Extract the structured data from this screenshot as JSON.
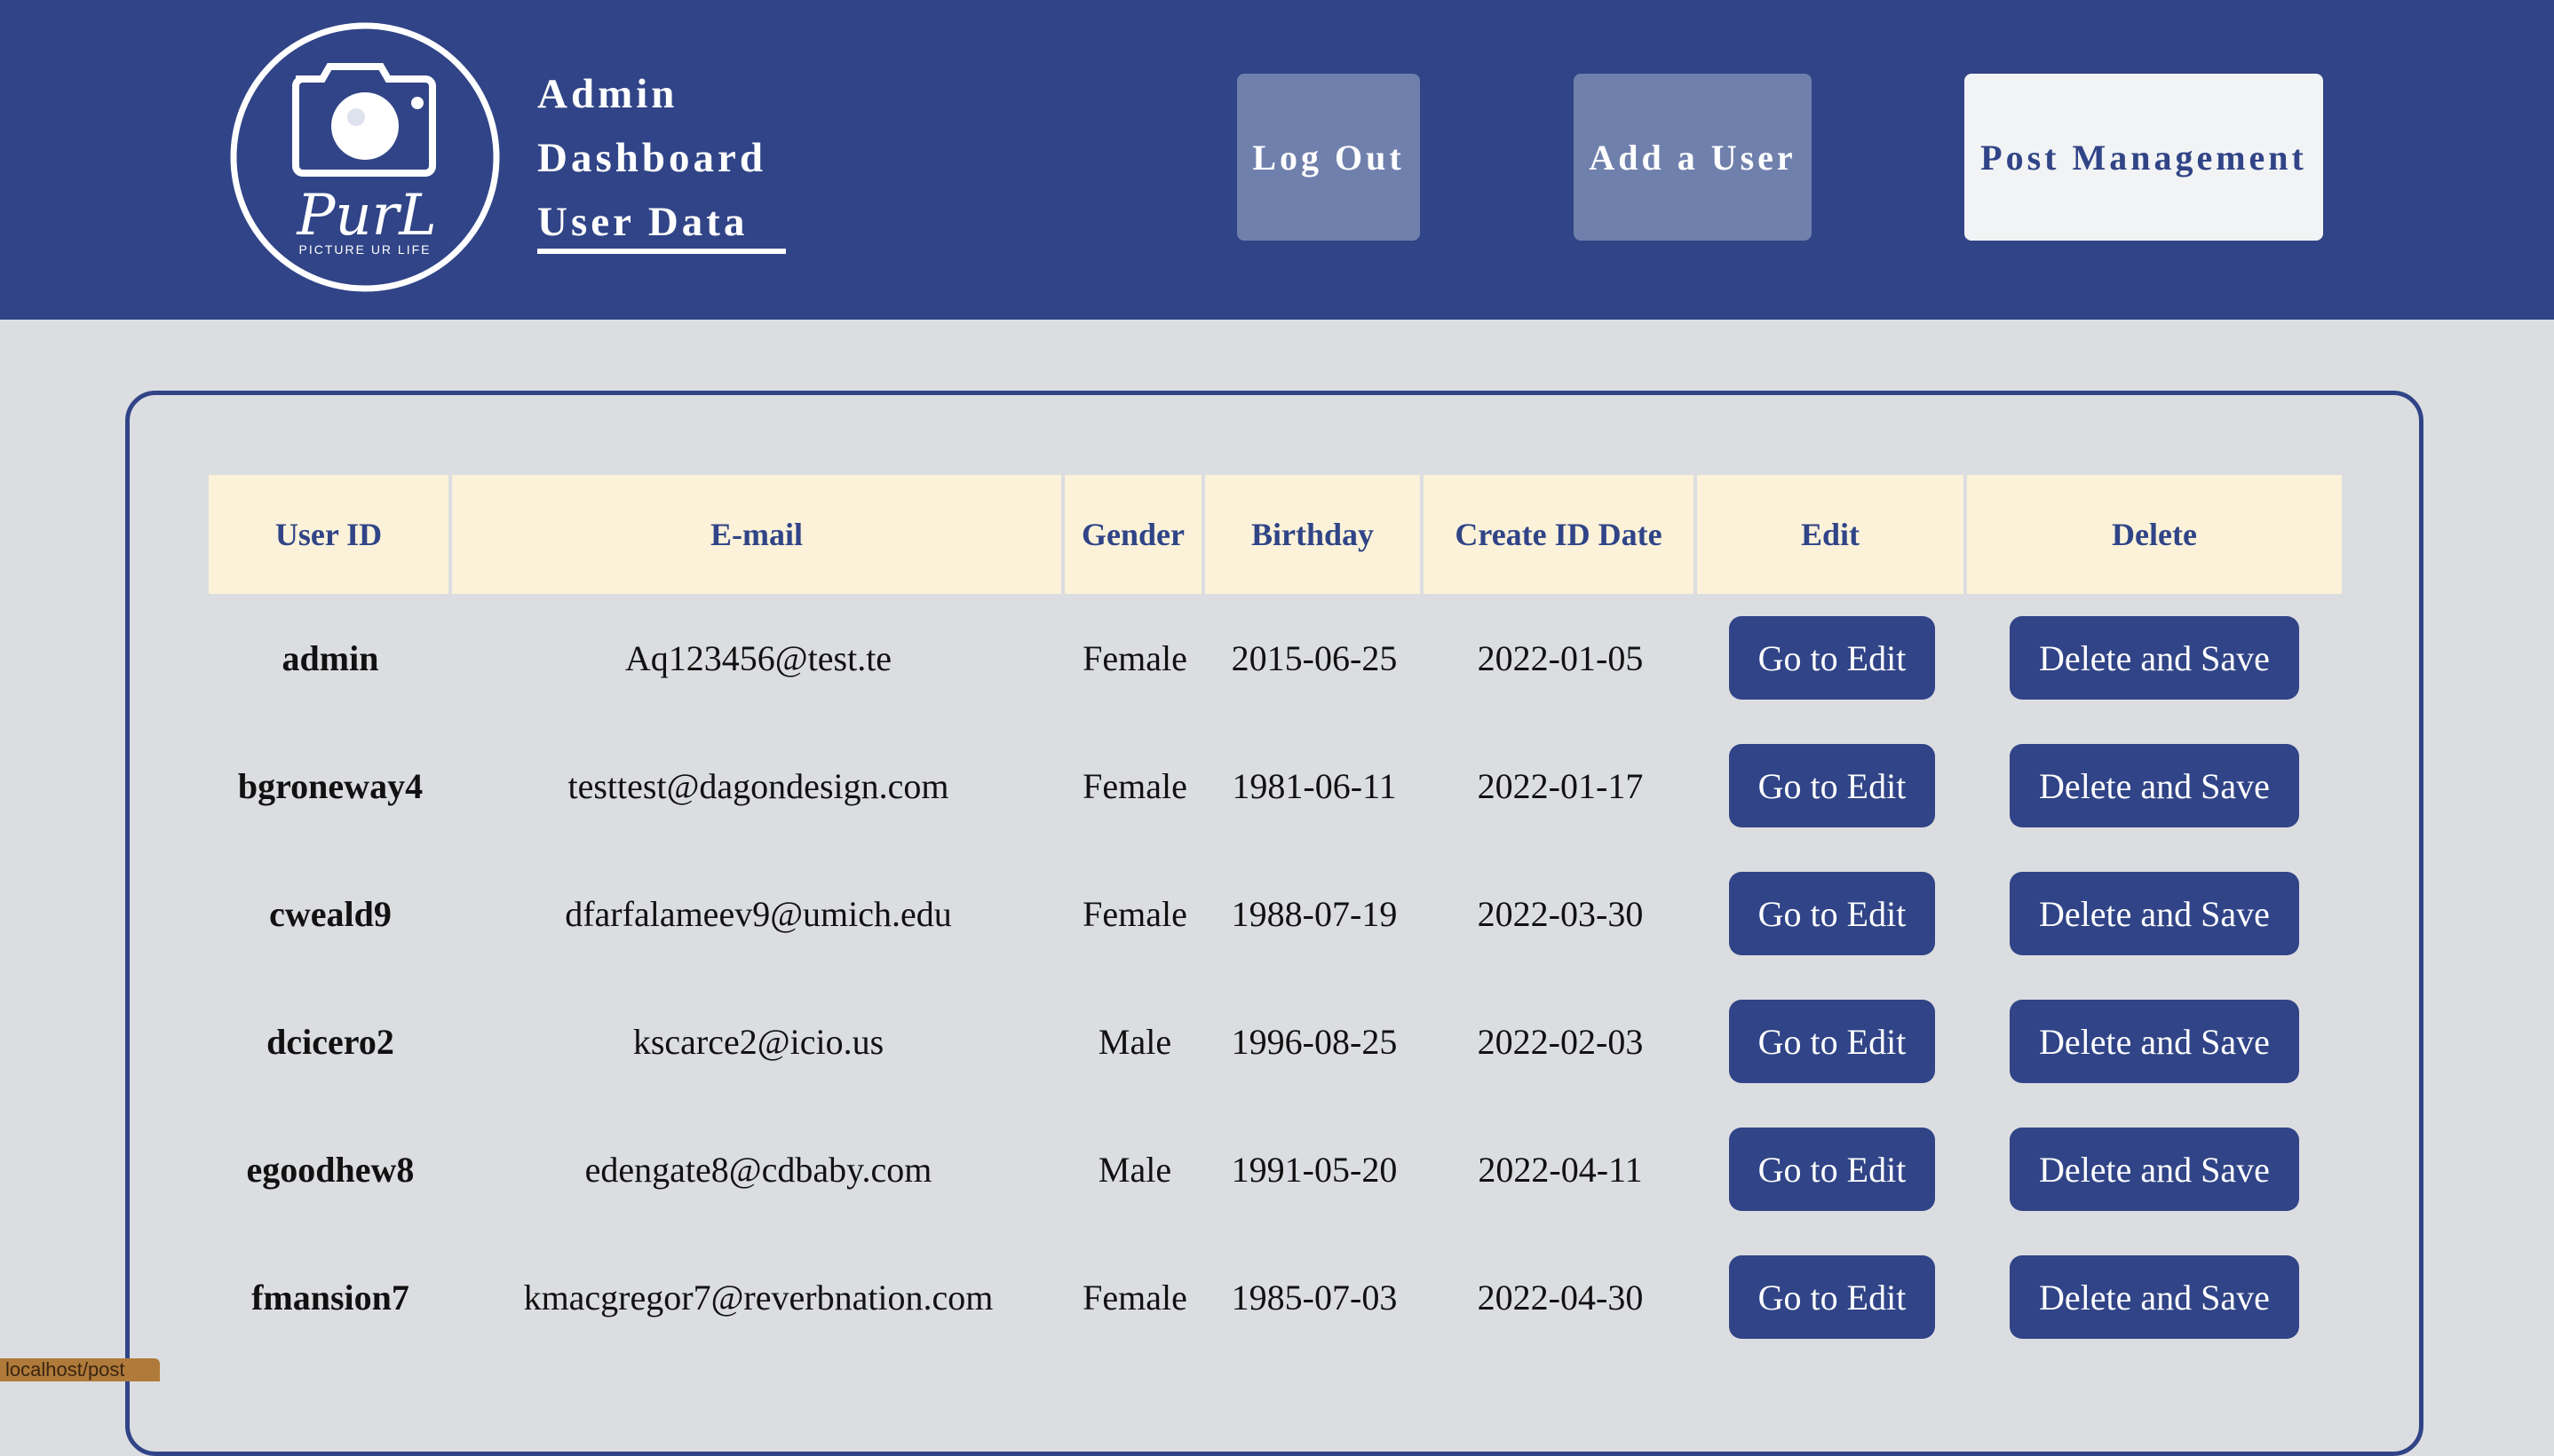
{
  "header": {
    "logo_text": "PurL",
    "logo_tagline": "PICTURE UR LIFE",
    "title_line1": "Admin",
    "title_line2": "Dashboard",
    "title_line3": "User Data",
    "logout_label": "Log Out",
    "add_user_label": "Add a User",
    "post_management_label": "Post Management"
  },
  "table": {
    "headers": [
      "User ID",
      "E-mail",
      "Gender",
      "Birthday",
      "Create ID Date",
      "Edit",
      "Delete"
    ],
    "rows": [
      {
        "user_id": "admin",
        "email": "Aq123456@test.te",
        "gender": "Female",
        "birthday": "2015-06-25",
        "created": "2022-01-05",
        "edit": "Go to Edit",
        "delete": "Delete and Save"
      },
      {
        "user_id": "bgroneway4",
        "email": "testtest@dagondesign.com",
        "gender": "Female",
        "birthday": "1981-06-11",
        "created": "2022-01-17",
        "edit": "Go to Edit",
        "delete": "Delete and Save"
      },
      {
        "user_id": "cweald9",
        "email": "dfarfalameev9@umich.edu",
        "gender": "Female",
        "birthday": "1988-07-19",
        "created": "2022-03-30",
        "edit": "Go to Edit",
        "delete": "Delete and Save"
      },
      {
        "user_id": "dcicero2",
        "email": "kscarce2@icio.us",
        "gender": "Male",
        "birthday": "1996-08-25",
        "created": "2022-02-03",
        "edit": "Go to Edit",
        "delete": "Delete and Save"
      },
      {
        "user_id": "egoodhew8",
        "email": "edengate8@cdbaby.com",
        "gender": "Male",
        "birthday": "1991-05-20",
        "created": "2022-04-11",
        "edit": "Go to Edit",
        "delete": "Delete and Save"
      },
      {
        "user_id": "fmansion7",
        "email": "kmacgregor7@reverbnation.com",
        "gender": "Female",
        "birthday": "1985-07-03",
        "created": "2022-04-30",
        "edit": "Go to Edit",
        "delete": "Delete and Save"
      }
    ]
  },
  "status_bar": {
    "url": "localhost/post"
  },
  "colors": {
    "brand": "#304487",
    "header_bg": "#304487",
    "table_header_bg": "#fbf2d9",
    "page_bg": "#dcdde0"
  }
}
